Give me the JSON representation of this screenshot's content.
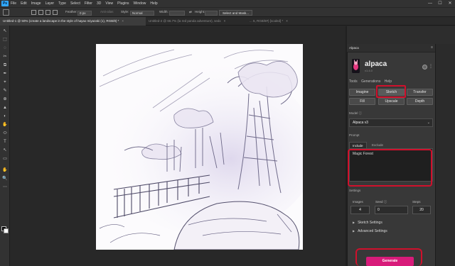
{
  "menu": {
    "logo": "Ps",
    "items": [
      "File",
      "Edit",
      "Image",
      "Layer",
      "Type",
      "Select",
      "Filter",
      "3D",
      "View",
      "Plugins",
      "Window",
      "Help"
    ],
    "window_controls": [
      "—",
      "☐",
      "✕"
    ]
  },
  "options": {
    "feather_label": "Feather:",
    "feather_value": "0 px",
    "anti_alias": "Anti-alias",
    "style_label": "Style:",
    "style_value": "Normal",
    "width_label": "Width:",
    "height_label": "Height:",
    "select_mask": "Select and Mask..."
  },
  "tabs": [
    {
      "label": "Untitled-1 @ 50% (create a landscape in the style of hayao miyazaki (1), RGB/8) *",
      "close": "×"
    },
    {
      "label": "Untitled-2 @ 66.7% (la red panda adventure), sedx",
      "close": "×"
    },
    {
      "label": "... 6, RGB/8#) [scaled] *",
      "close": "×"
    }
  ],
  "tools": [
    "↖",
    "⬚",
    "◌",
    "✂",
    "⧉",
    "✒",
    "⌖",
    "✎",
    "⊕",
    "▲",
    "◐",
    "✋",
    "⬭",
    "T",
    "↖",
    "▭",
    "✋",
    "🔍",
    "⋯"
  ],
  "panel": {
    "title": "Alpaca",
    "menu": "≡",
    "brand_name": "alpaca",
    "brand_version": "v1.4.0",
    "more": "⋮",
    "links": [
      "Tools",
      "Generations",
      "Help"
    ],
    "modes": [
      "Imagine",
      "Sketch",
      "Transfer",
      "Fill",
      "Upscale",
      "Depth"
    ],
    "active_mode": "Sketch",
    "model_label": "Model ⓘ",
    "model_value": "Alpaca v3",
    "model_chevron": "⌄",
    "prompt_label": "Prompt",
    "prompt_tabs": [
      "Include",
      "Exclude"
    ],
    "prompt_text": "Magic Forest",
    "settings_label": "Settings",
    "images_label": "Images",
    "images_value": "4",
    "seed_label": "Seed ⓘ",
    "seed_value": "0",
    "steps_label": "Steps",
    "steps_value": "20",
    "expanders": [
      "Sketch Settings",
      "Advanced Settings"
    ],
    "generate_label": "Generate"
  },
  "colors": {
    "highlight": "#d0102c",
    "generate": "#d81b7a",
    "ps_blue": "#31a8ff"
  }
}
